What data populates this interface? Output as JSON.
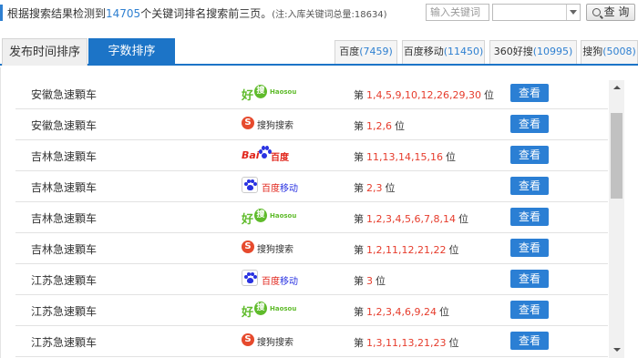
{
  "summary": {
    "prefix": "根据搜索结果检测到",
    "count": "14705",
    "suffix": "个关键词排名搜索前三页。",
    "note": "(注:入库关键词总量:18634)"
  },
  "search": {
    "placeholder": "输入关键词",
    "select_value": "",
    "button_label": "查 询"
  },
  "tabs": {
    "publish_time": "发布时间排序",
    "word_count": "字数排序"
  },
  "engines": [
    {
      "name": "百度",
      "count": "(7459)"
    },
    {
      "name": "百度移动",
      "count": "(11450)"
    },
    {
      "name": "360好搜",
      "count": "(10995)"
    },
    {
      "name": "搜狗",
      "count": "(5008)"
    }
  ],
  "logos": {
    "haosou": {
      "hao": "好",
      "sou": "搜",
      "small": "Haosou"
    },
    "sogou": {
      "s": "S",
      "text": "搜狗搜索"
    },
    "baidu": {
      "bai": "Bai",
      "du": "百度"
    },
    "baidu_mobile": {
      "a": "百度",
      "b": "移动"
    }
  },
  "rank_prefix": "第",
  "rank_suffix": "位",
  "view_label": "查看",
  "rows": [
    {
      "keyword": "安徽急速顆车",
      "engine": "haosou",
      "positions": "1,4,5,9,10,12,26,29,30"
    },
    {
      "keyword": "安徽急速顆车",
      "engine": "sogou",
      "positions": "1,2,6"
    },
    {
      "keyword": "吉林急速顆车",
      "engine": "baidu",
      "positions": "11,13,14,15,16"
    },
    {
      "keyword": "吉林急速顆车",
      "engine": "baidu_mobile",
      "positions": "2,3"
    },
    {
      "keyword": "吉林急速顆车",
      "engine": "haosou",
      "positions": "1,2,3,4,5,6,7,8,14"
    },
    {
      "keyword": "吉林急速顆车",
      "engine": "sogou",
      "positions": "1,2,11,12,21,22"
    },
    {
      "keyword": "江苏急速顆车",
      "engine": "baidu_mobile",
      "positions": "3"
    },
    {
      "keyword": "江苏急速顆车",
      "engine": "haosou",
      "positions": "1,2,3,4,6,9,24"
    },
    {
      "keyword": "江苏急速顆车",
      "engine": "sogou",
      "positions": "1,3,11,13,21,23"
    }
  ]
}
